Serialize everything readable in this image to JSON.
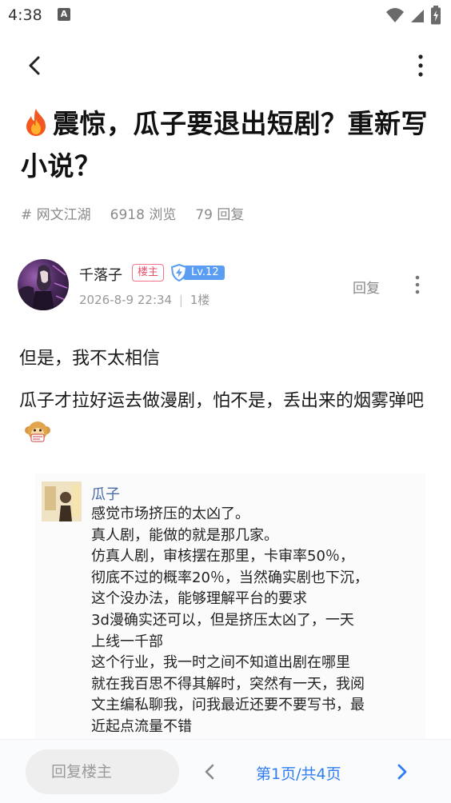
{
  "status_bar": {
    "time": "4:38",
    "a_icon": "A"
  },
  "post": {
    "title": "震惊，瓜子要退出短剧？重新写小说？",
    "category": "# 网文江湖",
    "views": "6918 浏览",
    "replies": "79 回复"
  },
  "author": {
    "name": "千落子",
    "op_badge": "楼主",
    "level": "Lv.12",
    "time": "2026-8-9 22:34",
    "separator": "|",
    "floor": "1楼",
    "reply": "回复"
  },
  "content": {
    "line1": "但是，我不太相信",
    "line2": "瓜子才拉好运去做漫剧，怕不是，丢出来的烟雾弹吧"
  },
  "screenshot": {
    "name": "瓜子",
    "lines": [
      "感觉市场挤压的太凶了。",
      "真人剧，能做的就是那几家。",
      "仿真人剧，审核摆在那里，卡审率50％，",
      "彻底不过的概率20％，当然确实剧也下沉，",
      "这个没办法，能够理解平台的要求",
      "3d漫确实还可以，但是挤压太凶了，一天",
      "上线一千部",
      "这个行业，我一时之间不知道出剧在哪里",
      "就在我百思不得其解时，突然有一天，我阅",
      "文主编私聊我，问我最近还要不要写书，最",
      "近起点流量不错"
    ]
  },
  "bottom_bar": {
    "reply_placeholder": "回复楼主",
    "page": "第1页/共4页"
  },
  "icons": {
    "back": "back-arrow-icon",
    "more": "more-vertical-icon",
    "fire": "fire-emoji-icon",
    "level_shield": "lightning-shield-icon",
    "monkey": "monkey-emoji-icon",
    "prev": "chevron-left-icon",
    "next": "chevron-right-icon"
  },
  "colors": {
    "accent_blue": "#2f7df0",
    "op_badge_pink": "#e8506a",
    "level_blue": "#5b9df3",
    "meta_gray": "#8a8a8a"
  }
}
